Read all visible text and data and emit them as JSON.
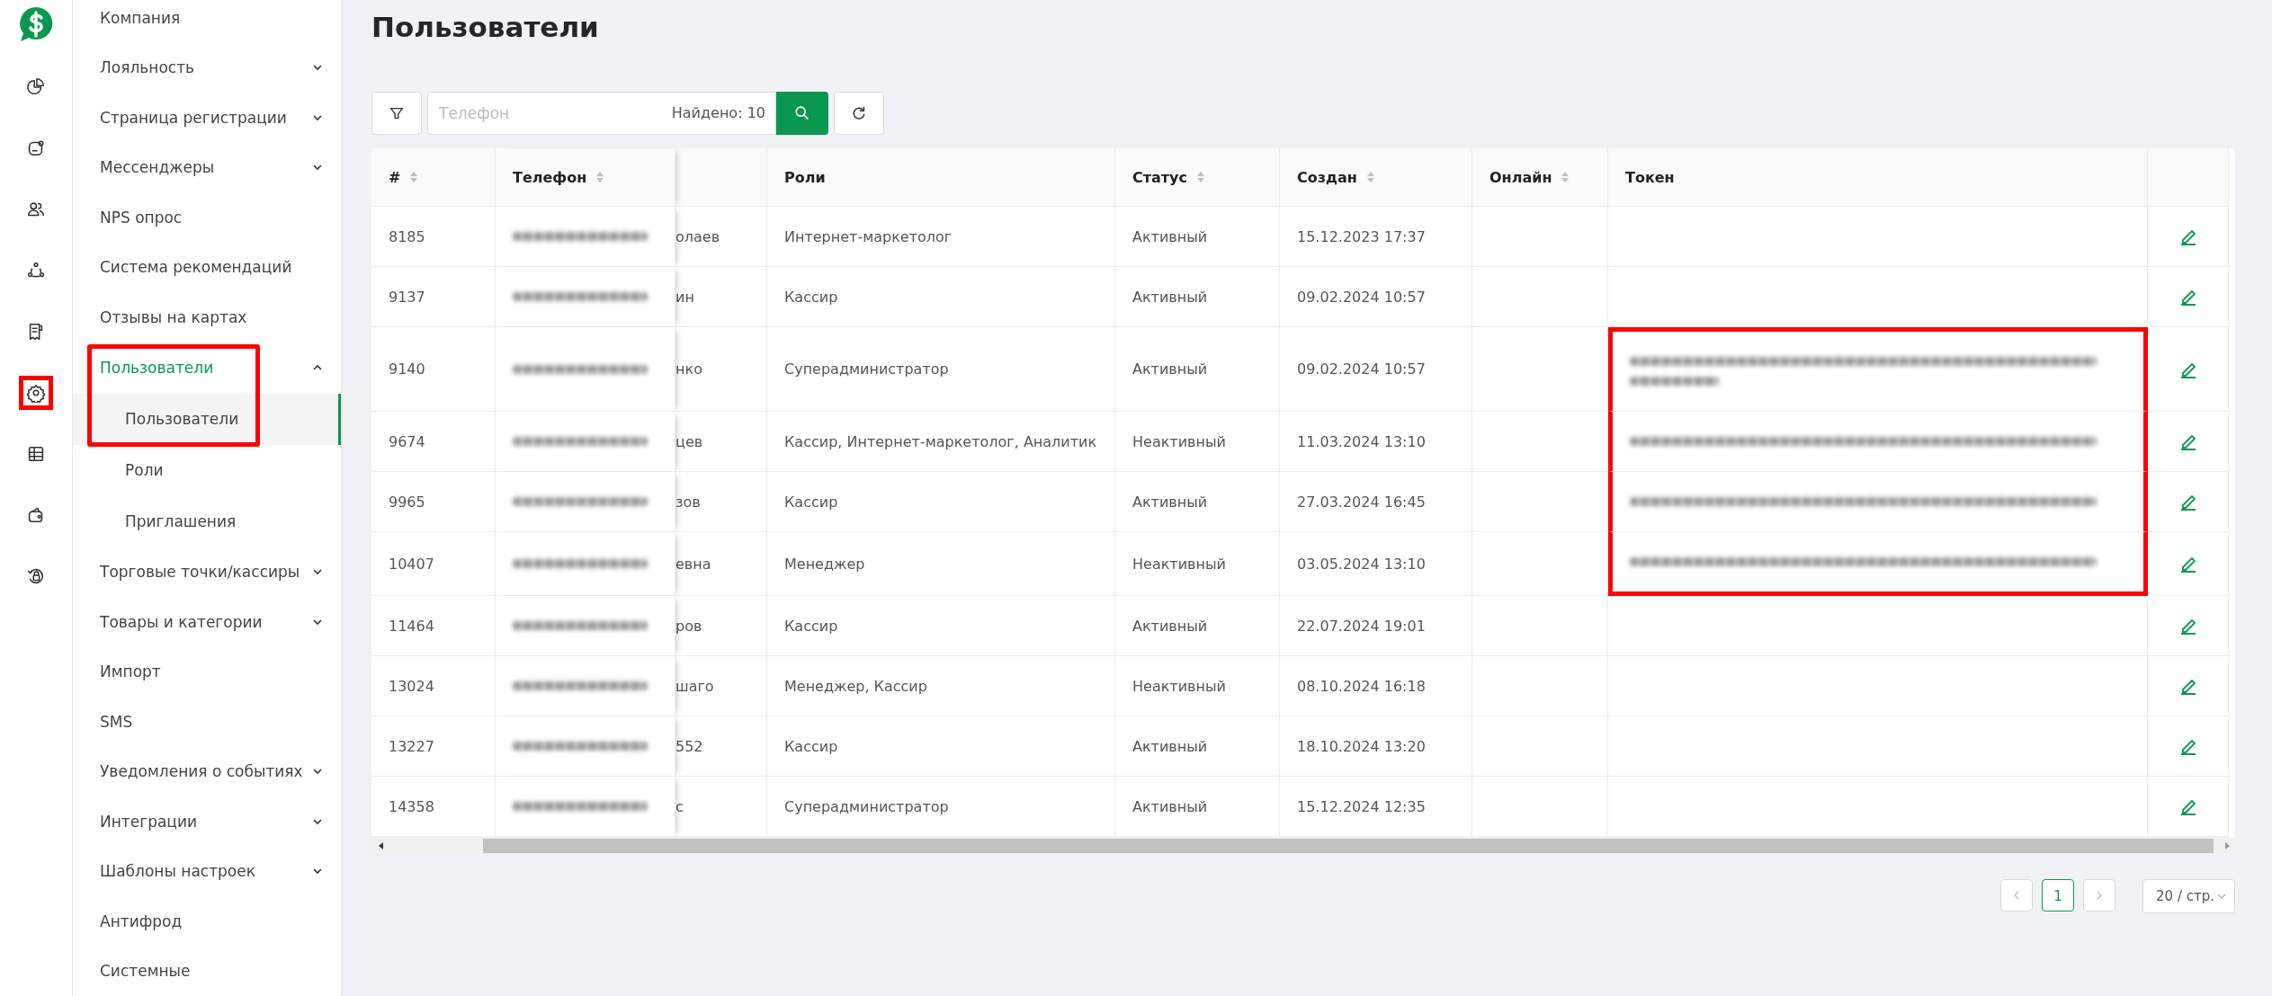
{
  "rail": [
    {
      "highlighted": false
    },
    {
      "highlighted": false
    },
    {
      "highlighted": false
    },
    {
      "highlighted": false
    },
    {
      "highlighted": false
    },
    {
      "highlighted": true
    },
    {
      "highlighted": false
    },
    {
      "highlighted": false
    },
    {
      "highlighted": false
    }
  ],
  "sidebar": {
    "items": [
      {
        "label": "Компания",
        "selected": false
      },
      {
        "label": "Лояльность",
        "selected": false,
        "expanded": false
      },
      {
        "label": "Страница регистрации",
        "selected": false,
        "expanded": false
      },
      {
        "label": "Мессенджеры",
        "selected": false,
        "expanded": false
      },
      {
        "label": "NPS опрос",
        "selected": false
      },
      {
        "label": "Система рекомендаций",
        "selected": false
      },
      {
        "label": "Отзывы на картах",
        "selected": false
      },
      {
        "label": "Пользователи",
        "selected": true,
        "expanded": true,
        "highlighted": true,
        "children": [
          {
            "label": "Пользователи",
            "selected": true
          },
          {
            "label": "Роли",
            "selected": false
          },
          {
            "label": "Приглашения",
            "selected": false
          }
        ]
      },
      {
        "label": "Торговые точки/кассиры",
        "selected": false,
        "expanded": false
      },
      {
        "label": "Товары и категории",
        "selected": false,
        "expanded": false
      },
      {
        "label": "Импорт",
        "selected": false
      },
      {
        "label": "SMS",
        "selected": false
      },
      {
        "label": "Уведомления о событиях",
        "selected": false,
        "expanded": false
      },
      {
        "label": "Интеграции",
        "selected": false,
        "expanded": false
      },
      {
        "label": "Шаблоны настроек",
        "selected": false,
        "expanded": false
      },
      {
        "label": "Антифрод",
        "selected": false
      },
      {
        "label": "Системные",
        "selected": false
      }
    ]
  },
  "page": {
    "title": "Пользователи"
  },
  "search": {
    "placeholder": "Телефон",
    "found": "Найдено: 10"
  },
  "table": {
    "columns": [
      {
        "label": "#",
        "sortable": true
      },
      {
        "label": "Телефон",
        "sortable": true
      },
      {
        "label": "Роли",
        "sortable": false
      },
      {
        "label": "Статус",
        "sortable": true
      },
      {
        "label": "Создан",
        "sortable": true
      },
      {
        "label": "Онлайн",
        "sortable": true
      },
      {
        "label": "Токен",
        "sortable": false
      }
    ],
    "rows": [
      {
        "id": "8185",
        "phone_blurred": true,
        "column_3": "олаев",
        "roles": "Интернет-маркетолог",
        "status": "Активный",
        "created": "15.12.2023 17:37",
        "token_blurred": false,
        "token_highlighted": false
      },
      {
        "id": "9137",
        "phone_blurred": true,
        "column_3": "ин",
        "roles": "Кассир",
        "status": "Активный",
        "created": "09.02.2024 10:57",
        "token_blurred": false,
        "token_highlighted": false
      },
      {
        "id": "9140",
        "phone_blurred": true,
        "column_3": "нко",
        "roles": "Суперадминистратор",
        "status": "Активный",
        "created": "09.02.2024 10:57",
        "token_blurred": true,
        "token_highlighted": true
      },
      {
        "id": "9674",
        "phone_blurred": true,
        "column_3": "цев",
        "roles": "Кассир, Интернет-маркетолог, Аналитик",
        "status": "Неактивный",
        "created": "11.03.2024 13:10",
        "token_blurred": true,
        "token_highlighted": true
      },
      {
        "id": "9965",
        "phone_blurred": true,
        "column_3": "зов",
        "roles": "Кассир",
        "status": "Активный",
        "created": "27.03.2024 16:45",
        "token_blurred": true,
        "token_highlighted": true
      },
      {
        "id": "10407",
        "phone_blurred": true,
        "column_3": "евна",
        "roles": "Менеджер",
        "status": "Неактивный",
        "created": "03.05.2024 13:10",
        "token_blurred": true,
        "token_highlighted": true
      },
      {
        "id": "11464",
        "phone_blurred": true,
        "column_3": "ров",
        "roles": "Кассир",
        "status": "Активный",
        "created": "22.07.2024 19:01",
        "token_blurred": false,
        "token_highlighted": false
      },
      {
        "id": "13024",
        "phone_blurred": true,
        "column_3": "шаго",
        "roles": "Менеджер, Кассир",
        "status": "Неактивный",
        "created": "08.10.2024 16:18",
        "token_blurred": false,
        "token_highlighted": false
      },
      {
        "id": "13227",
        "phone_blurred": true,
        "column_3": "552",
        "roles": "Кассир",
        "status": "Активный",
        "created": "18.10.2024 13:20",
        "token_blurred": false,
        "token_highlighted": false
      },
      {
        "id": "14358",
        "phone_blurred": true,
        "column_3": "с",
        "roles": "Суперадминистратор",
        "status": "Активный",
        "created": "15.12.2024 12:35",
        "token_blurred": false,
        "token_highlighted": false
      }
    ]
  },
  "pagination": {
    "pages": [
      {
        "label": "1",
        "selected": true
      }
    ],
    "page_size": "20 / стр."
  }
}
